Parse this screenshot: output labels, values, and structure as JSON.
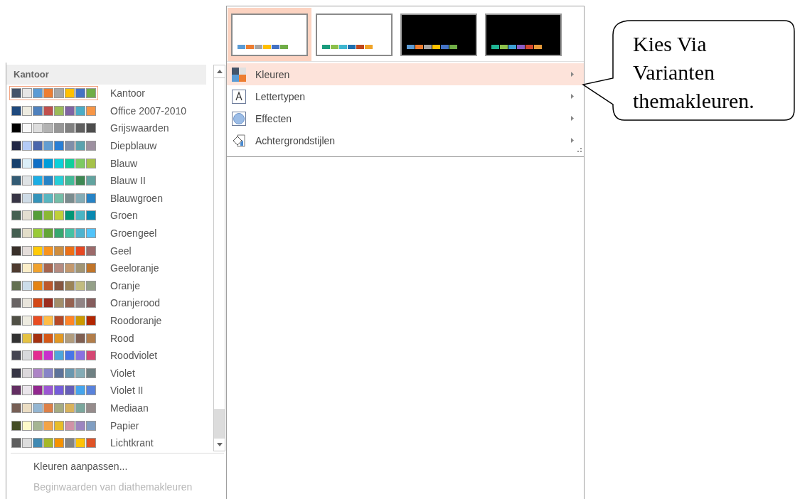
{
  "variants": [
    {
      "kind": "light",
      "selected": true,
      "swatches": [
        {
          "color": "#5b9bd5"
        },
        {
          "color": "#ed7d31"
        },
        {
          "color": "#a5a5a5"
        },
        {
          "color": "#ffc000"
        },
        {
          "color": "#4472c4"
        },
        {
          "color": "#70ad47"
        }
      ]
    },
    {
      "kind": "light",
      "selected": false,
      "swatches": [
        {
          "color": "#1a9b7c"
        },
        {
          "color": "#8cc04b"
        },
        {
          "color": "#3fb6d0"
        },
        {
          "color": "#1e6fae"
        },
        {
          "color": "#c0461c"
        },
        {
          "color": "#f0a428"
        }
      ]
    },
    {
      "kind": "dark",
      "selected": false,
      "swatches": [
        {
          "color": "#5b9bd5"
        },
        {
          "color": "#ed7d31"
        },
        {
          "color": "#a5a5a5"
        },
        {
          "color": "#ffc000"
        },
        {
          "color": "#4472c4"
        },
        {
          "color": "#70ad47"
        }
      ]
    },
    {
      "kind": "dark",
      "selected": false,
      "swatches": [
        {
          "color": "#1fb493"
        },
        {
          "color": "#8cc04b"
        },
        {
          "color": "#3fa0d5"
        },
        {
          "color": "#8a5cc6"
        },
        {
          "color": "#d2482e"
        },
        {
          "color": "#e59a3a"
        }
      ]
    }
  ],
  "menu_items": [
    {
      "kind": "colors",
      "label": "Kleuren",
      "selected": true
    },
    {
      "kind": "fonts",
      "label": "Lettertypen",
      "selected": false
    },
    {
      "kind": "effects",
      "label": "Effecten",
      "selected": false
    },
    {
      "kind": "background",
      "label": "Achtergrondstijlen",
      "selected": false
    }
  ],
  "palette_panel": {
    "header": "Kantoor",
    "palettes": [
      {
        "name": "Kantoor",
        "selected": true,
        "swatches": [
          {
            "color": "#44546a"
          },
          {
            "color": "#e7e6e6"
          },
          {
            "color": "#5b9bd5"
          },
          {
            "color": "#ed7d31"
          },
          {
            "color": "#a5a5a5"
          },
          {
            "color": "#ffc000"
          },
          {
            "color": "#4472c4"
          },
          {
            "color": "#70ad47"
          }
        ]
      },
      {
        "name": "Office 2007-2010",
        "selected": false,
        "swatches": [
          {
            "color": "#1f497d"
          },
          {
            "color": "#eeece1"
          },
          {
            "color": "#4f81bd"
          },
          {
            "color": "#c0504d"
          },
          {
            "color": "#9bbb59"
          },
          {
            "color": "#8064a2"
          },
          {
            "color": "#4bacc6"
          },
          {
            "color": "#f79646"
          }
        ]
      },
      {
        "name": "Grijswaarden",
        "selected": false,
        "swatches": [
          {
            "color": "#000000"
          },
          {
            "color": "#f8f8f8"
          },
          {
            "color": "#dddddd"
          },
          {
            "color": "#b2b2b2"
          },
          {
            "color": "#969696"
          },
          {
            "color": "#808080"
          },
          {
            "color": "#5f5f5f"
          },
          {
            "color": "#4d4d4d"
          }
        ]
      },
      {
        "name": "Diepblauw",
        "selected": false,
        "swatches": [
          {
            "color": "#212745"
          },
          {
            "color": "#b4cbf7"
          },
          {
            "color": "#4a66ac"
          },
          {
            "color": "#629dd1"
          },
          {
            "color": "#297fd5"
          },
          {
            "color": "#7f8fa9"
          },
          {
            "color": "#5aa2ae"
          },
          {
            "color": "#9d90a0"
          }
        ]
      },
      {
        "name": "Blauw",
        "selected": false,
        "swatches": [
          {
            "color": "#17406d"
          },
          {
            "color": "#dbeff9"
          },
          {
            "color": "#0f6fc6"
          },
          {
            "color": "#009dd9"
          },
          {
            "color": "#0bd0d9"
          },
          {
            "color": "#10cf9b"
          },
          {
            "color": "#7cca62"
          },
          {
            "color": "#a5c249"
          }
        ]
      },
      {
        "name": "Blauw II",
        "selected": false,
        "swatches": [
          {
            "color": "#335b74"
          },
          {
            "color": "#dfe3e5"
          },
          {
            "color": "#1cade4"
          },
          {
            "color": "#2683c6"
          },
          {
            "color": "#27ced7"
          },
          {
            "color": "#42ba97"
          },
          {
            "color": "#3e8853"
          },
          {
            "color": "#62a39f"
          }
        ]
      },
      {
        "name": "Blauwgroen",
        "selected": false,
        "swatches": [
          {
            "color": "#373545"
          },
          {
            "color": "#cedbe6"
          },
          {
            "color": "#3494ba"
          },
          {
            "color": "#58b6c0"
          },
          {
            "color": "#75bda7"
          },
          {
            "color": "#7a8c8e"
          },
          {
            "color": "#84acb6"
          },
          {
            "color": "#2683c6"
          }
        ]
      },
      {
        "name": "Groen",
        "selected": false,
        "swatches": [
          {
            "color": "#455f51"
          },
          {
            "color": "#e3ded1"
          },
          {
            "color": "#549e39"
          },
          {
            "color": "#8ab833"
          },
          {
            "color": "#c0cf3a"
          },
          {
            "color": "#029676"
          },
          {
            "color": "#4ab5c4"
          },
          {
            "color": "#0989b1"
          }
        ]
      },
      {
        "name": "Groengeel",
        "selected": false,
        "swatches": [
          {
            "color": "#455f51"
          },
          {
            "color": "#e3dec9"
          },
          {
            "color": "#99cb38"
          },
          {
            "color": "#63a537"
          },
          {
            "color": "#37a76f"
          },
          {
            "color": "#44c1a3"
          },
          {
            "color": "#4eb3cf"
          },
          {
            "color": "#51c3f9"
          }
        ]
      },
      {
        "name": "Geel",
        "selected": false,
        "swatches": [
          {
            "color": "#39302a"
          },
          {
            "color": "#e5dedb"
          },
          {
            "color": "#ffca08"
          },
          {
            "color": "#f8931d"
          },
          {
            "color": "#ce8d3e"
          },
          {
            "color": "#ec7016"
          },
          {
            "color": "#e64823"
          },
          {
            "color": "#9c6a6a"
          }
        ]
      },
      {
        "name": "Geeloranje",
        "selected": false,
        "swatches": [
          {
            "color": "#4e3b30"
          },
          {
            "color": "#fbeec9"
          },
          {
            "color": "#f0a22e"
          },
          {
            "color": "#a5644e"
          },
          {
            "color": "#b58b80"
          },
          {
            "color": "#c3986d"
          },
          {
            "color": "#a19574"
          },
          {
            "color": "#c17529"
          }
        ]
      },
      {
        "name": "Oranje",
        "selected": false,
        "swatches": [
          {
            "color": "#637052"
          },
          {
            "color": "#ccddea"
          },
          {
            "color": "#e48312"
          },
          {
            "color": "#bd582c"
          },
          {
            "color": "#865640"
          },
          {
            "color": "#9b8357"
          },
          {
            "color": "#c2bc80"
          },
          {
            "color": "#94a088"
          }
        ]
      },
      {
        "name": "Oranjerood",
        "selected": false,
        "swatches": [
          {
            "color": "#696464"
          },
          {
            "color": "#e9e5dc"
          },
          {
            "color": "#d34817"
          },
          {
            "color": "#9b2d1f"
          },
          {
            "color": "#a28e6a"
          },
          {
            "color": "#956251"
          },
          {
            "color": "#918485"
          },
          {
            "color": "#855d5d"
          }
        ]
      },
      {
        "name": "Roodoranje",
        "selected": false,
        "swatches": [
          {
            "color": "#505046"
          },
          {
            "color": "#eeece1"
          },
          {
            "color": "#e84c22"
          },
          {
            "color": "#ffbd47"
          },
          {
            "color": "#b64926"
          },
          {
            "color": "#ff8427"
          },
          {
            "color": "#cc9900"
          },
          {
            "color": "#b22600"
          }
        ]
      },
      {
        "name": "Rood",
        "selected": false,
        "swatches": [
          {
            "color": "#323232"
          },
          {
            "color": "#e5c243"
          },
          {
            "color": "#a5300f"
          },
          {
            "color": "#d55816"
          },
          {
            "color": "#e19825"
          },
          {
            "color": "#b19c7d"
          },
          {
            "color": "#7f5f52"
          },
          {
            "color": "#b27d49"
          }
        ]
      },
      {
        "name": "Roodviolet",
        "selected": false,
        "swatches": [
          {
            "color": "#454551"
          },
          {
            "color": "#d8d9dc"
          },
          {
            "color": "#e32d91"
          },
          {
            "color": "#c830cc"
          },
          {
            "color": "#4ea6dc"
          },
          {
            "color": "#4775e7"
          },
          {
            "color": "#8971e1"
          },
          {
            "color": "#d54773"
          }
        ]
      },
      {
        "name": "Violet",
        "selected": false,
        "swatches": [
          {
            "color": "#373545"
          },
          {
            "color": "#dcd8dc"
          },
          {
            "color": "#ad84c6"
          },
          {
            "color": "#8784c7"
          },
          {
            "color": "#5d739a"
          },
          {
            "color": "#6997af"
          },
          {
            "color": "#84acb6"
          },
          {
            "color": "#6f8183"
          }
        ]
      },
      {
        "name": "Violet II",
        "selected": false,
        "swatches": [
          {
            "color": "#632e62"
          },
          {
            "color": "#eae5eb"
          },
          {
            "color": "#92278f"
          },
          {
            "color": "#9b57d3"
          },
          {
            "color": "#755dd9"
          },
          {
            "color": "#665eb8"
          },
          {
            "color": "#45a5ed"
          },
          {
            "color": "#5982db"
          }
        ]
      },
      {
        "name": "Mediaan",
        "selected": false,
        "swatches": [
          {
            "color": "#775f55"
          },
          {
            "color": "#ebddc3"
          },
          {
            "color": "#94b6d2"
          },
          {
            "color": "#dd8047"
          },
          {
            "color": "#a5ab81"
          },
          {
            "color": "#d8b25c"
          },
          {
            "color": "#7ba79d"
          },
          {
            "color": "#968c8c"
          }
        ]
      },
      {
        "name": "Papier",
        "selected": false,
        "swatches": [
          {
            "color": "#444d26"
          },
          {
            "color": "#fefac9"
          },
          {
            "color": "#a5b592"
          },
          {
            "color": "#f3a447"
          },
          {
            "color": "#e7bc29"
          },
          {
            "color": "#d092a7"
          },
          {
            "color": "#9c85c0"
          },
          {
            "color": "#809ec2"
          }
        ]
      },
      {
        "name": "Lichtkrant",
        "selected": false,
        "swatches": [
          {
            "color": "#5e5e5e"
          },
          {
            "color": "#dddddd"
          },
          {
            "color": "#418ab3"
          },
          {
            "color": "#a6b727"
          },
          {
            "color": "#f69200"
          },
          {
            "color": "#838383"
          },
          {
            "color": "#fec306"
          },
          {
            "color": "#df5327"
          }
        ]
      }
    ],
    "footer": [
      {
        "label": "Kleuren aanpassen...",
        "disabled": false
      },
      {
        "label": "Beginwaarden van diathemakleuren",
        "disabled": true
      }
    ]
  },
  "callout": {
    "lines": [
      "Kies Via",
      "Varianten",
      "themakleuren."
    ]
  }
}
